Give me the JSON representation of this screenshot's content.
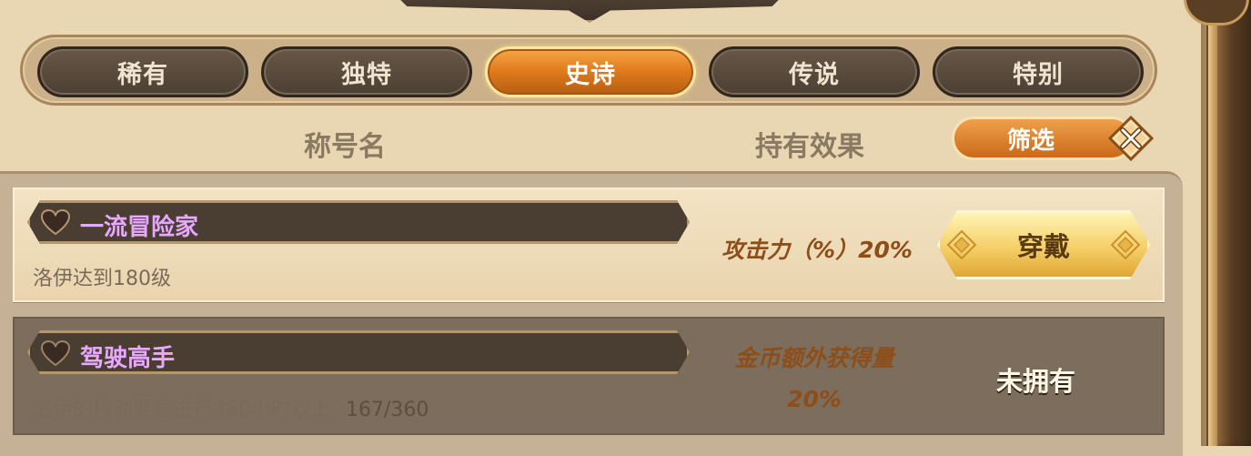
{
  "tabs": [
    {
      "label": "稀有",
      "active": false
    },
    {
      "label": "独特",
      "active": false
    },
    {
      "label": "史诗",
      "active": true
    },
    {
      "label": "传说",
      "active": false
    },
    {
      "label": "特别",
      "active": false
    }
  ],
  "columns": {
    "name_header": "称号名",
    "effect_header": "持有效果",
    "filter_label": "筛选"
  },
  "titles": [
    {
      "name": "一流冒险家",
      "condition": "洛伊达到180级",
      "progress": "",
      "effect_line1": "攻击力（%）20%",
      "effect_line2": "",
      "action_label": "穿戴",
      "owned": true
    },
    {
      "name": "驾驶高手",
      "condition": "洛伊的移动要塞进行360小时以上",
      "progress": "167/360",
      "effect_line1": "金币额外获得量",
      "effect_line2": "20%",
      "action_label": "未拥有",
      "owned": false
    }
  ],
  "colors": {
    "accent": "#e27d1d",
    "title_purple": "#e7a8ff",
    "effect_brown": "#8d4e1a"
  }
}
